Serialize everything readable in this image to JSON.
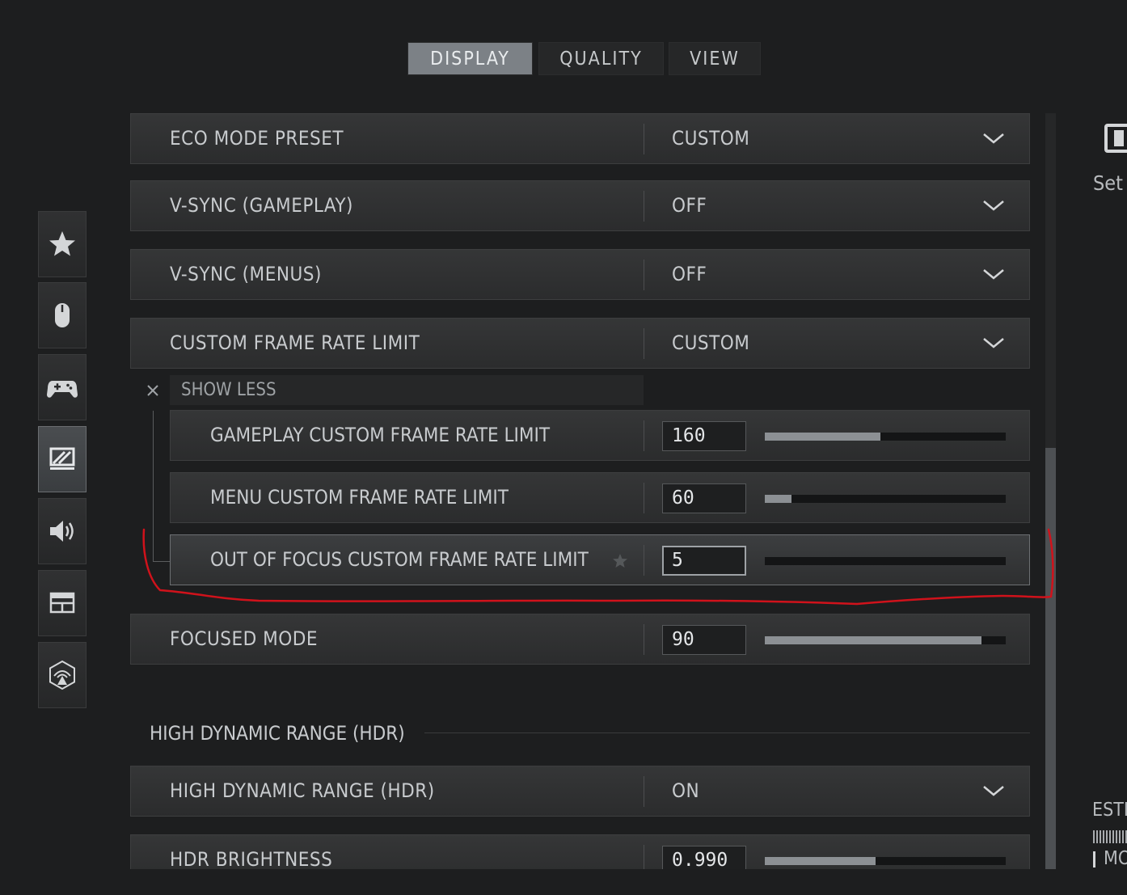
{
  "tabs": [
    {
      "label": "DISPLAY",
      "active": true
    },
    {
      "label": "QUALITY",
      "active": false
    },
    {
      "label": "VIEW",
      "active": false
    }
  ],
  "sidebar": [
    {
      "icon": "star-icon"
    },
    {
      "icon": "mouse-icon"
    },
    {
      "icon": "controller-icon"
    },
    {
      "icon": "display-icon",
      "active": true
    },
    {
      "icon": "speaker-icon"
    },
    {
      "icon": "interface-icon"
    },
    {
      "icon": "network-icon"
    }
  ],
  "settings": {
    "rows": [
      {
        "label": "ECO MODE PRESET",
        "value": "CUSTOM"
      },
      {
        "label": "V-SYNC (GAMEPLAY)",
        "value": "OFF"
      },
      {
        "label": "V-SYNC (MENUS)",
        "value": "OFF"
      },
      {
        "label": "CUSTOM FRAME RATE LIMIT",
        "value": "CUSTOM"
      }
    ],
    "show_less": "SHOW LESS",
    "frame_rate_sub": {
      "rows": [
        {
          "label": "GAMEPLAY CUSTOM FRAME RATE LIMIT",
          "value": "160",
          "fill": 0.48
        },
        {
          "label": "MENU CUSTOM FRAME RATE LIMIT",
          "value": "60",
          "fill": 0.11
        },
        {
          "label": "OUT OF FOCUS CUSTOM FRAME RATE LIMIT",
          "value": "5",
          "fill": 0.0
        }
      ]
    },
    "focused_mode": {
      "label": "FOCUSED MODE",
      "value": "90",
      "fill": 0.9
    }
  },
  "hdr": {
    "section_title": "HIGH DYNAMIC RANGE (HDR)",
    "rows": [
      {
        "label": "HIGH DYNAMIC RANGE (HDR)",
        "value": "ON"
      },
      {
        "label": "HDR BRIGHTNESS",
        "value": "0.990",
        "fill": 0.46
      }
    ]
  },
  "right_panel": {
    "text_set": "Set",
    "text_esti": "ESTI",
    "text_mo": "MO"
  },
  "colors": {
    "annotation": "#d0121b",
    "accent_active_tab": "#7c8186"
  }
}
